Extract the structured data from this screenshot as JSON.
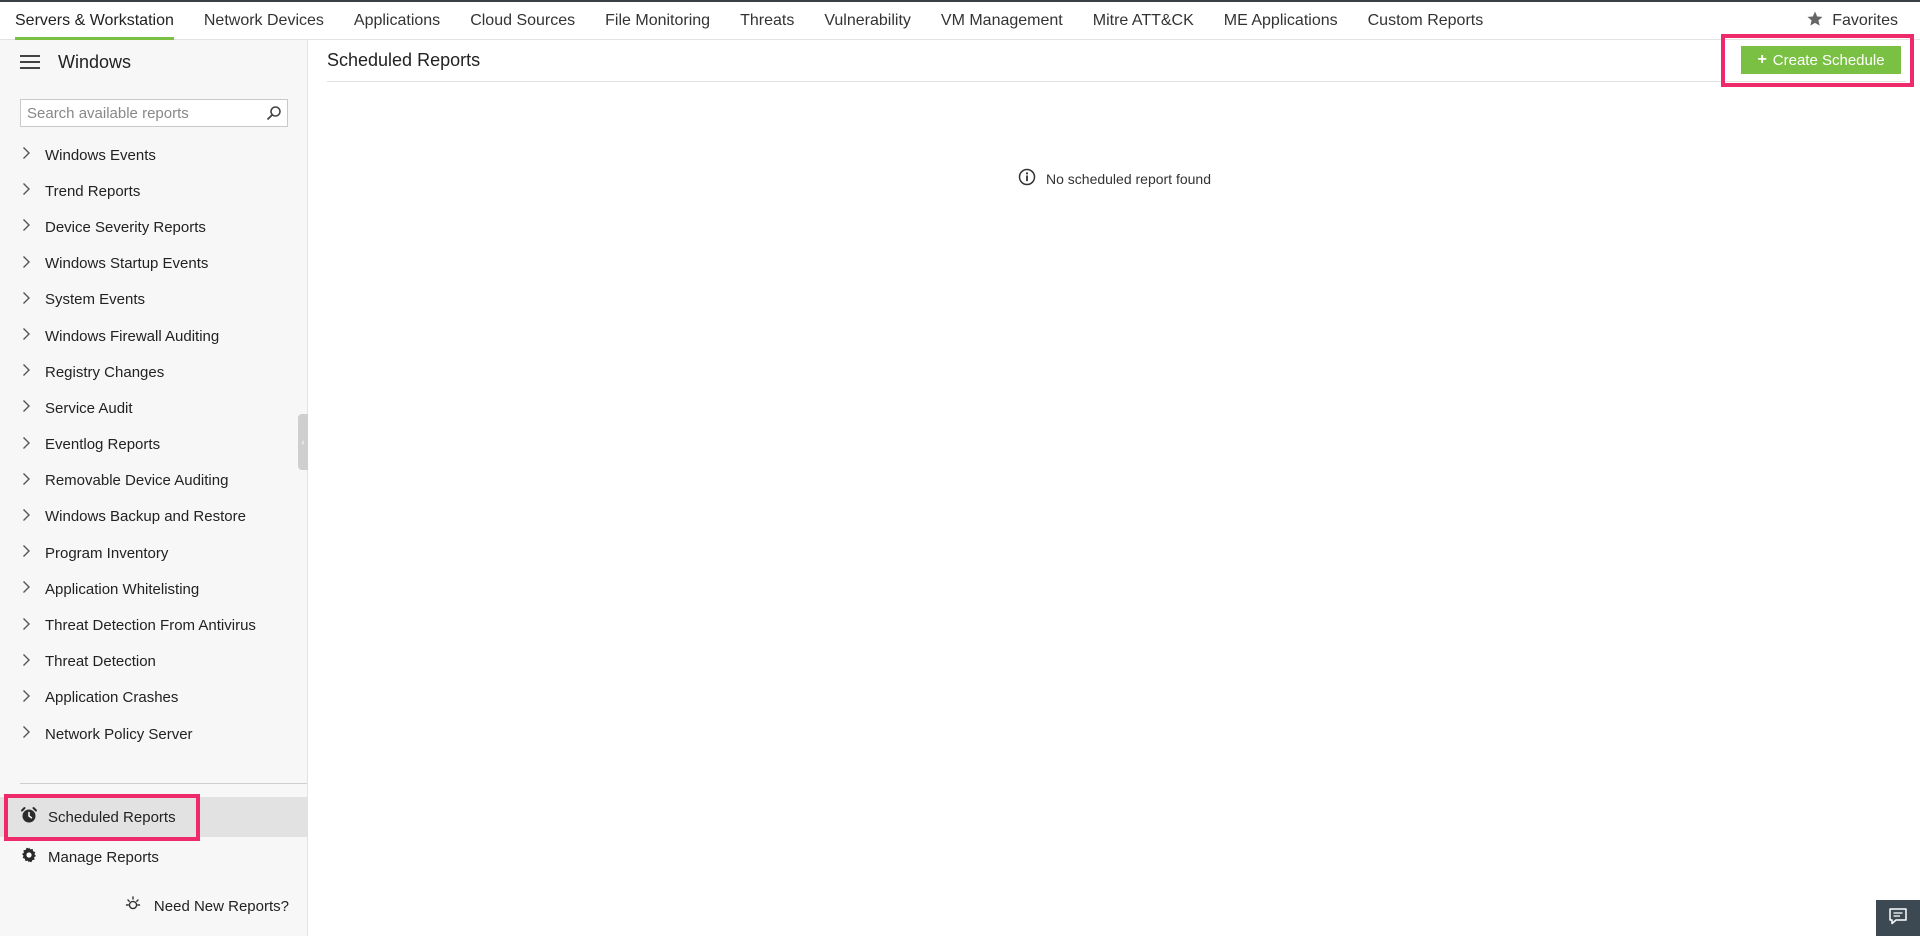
{
  "nav": {
    "tabs": [
      {
        "label": "Servers & Workstation"
      },
      {
        "label": "Network Devices"
      },
      {
        "label": "Applications"
      },
      {
        "label": "Cloud Sources"
      },
      {
        "label": "File Monitoring"
      },
      {
        "label": "Threats"
      },
      {
        "label": "Vulnerability"
      },
      {
        "label": "VM Management"
      },
      {
        "label": "Mitre ATT&CK"
      },
      {
        "label": "ME Applications"
      },
      {
        "label": "Custom Reports"
      }
    ],
    "favorites_label": "Favorites"
  },
  "sidebar": {
    "title": "Windows",
    "search_placeholder": "Search available reports",
    "categories": [
      {
        "label": "Windows Events"
      },
      {
        "label": "Trend Reports"
      },
      {
        "label": "Device Severity Reports"
      },
      {
        "label": "Windows Startup Events"
      },
      {
        "label": "System Events"
      },
      {
        "label": "Windows Firewall Auditing"
      },
      {
        "label": "Registry Changes"
      },
      {
        "label": "Service Audit"
      },
      {
        "label": "Eventlog Reports"
      },
      {
        "label": "Removable Device Auditing"
      },
      {
        "label": "Windows Backup and Restore"
      },
      {
        "label": "Program Inventory"
      },
      {
        "label": "Application Whitelisting"
      },
      {
        "label": "Threat Detection From Antivirus"
      },
      {
        "label": "Threat Detection"
      },
      {
        "label": "Application Crashes"
      },
      {
        "label": "Network Policy Server"
      }
    ],
    "scheduled_reports_label": "Scheduled Reports",
    "manage_reports_label": "Manage Reports",
    "need_new_label": "Need New Reports?"
  },
  "main": {
    "title": "Scheduled Reports",
    "create_label": "Create Schedule",
    "empty_message": "No scheduled report found"
  },
  "colors": {
    "accent": "#7ac143",
    "highlight": "#ee2a6b",
    "sidebar_bg": "#f7f7f7",
    "selected_bg": "#e2e2e2"
  }
}
